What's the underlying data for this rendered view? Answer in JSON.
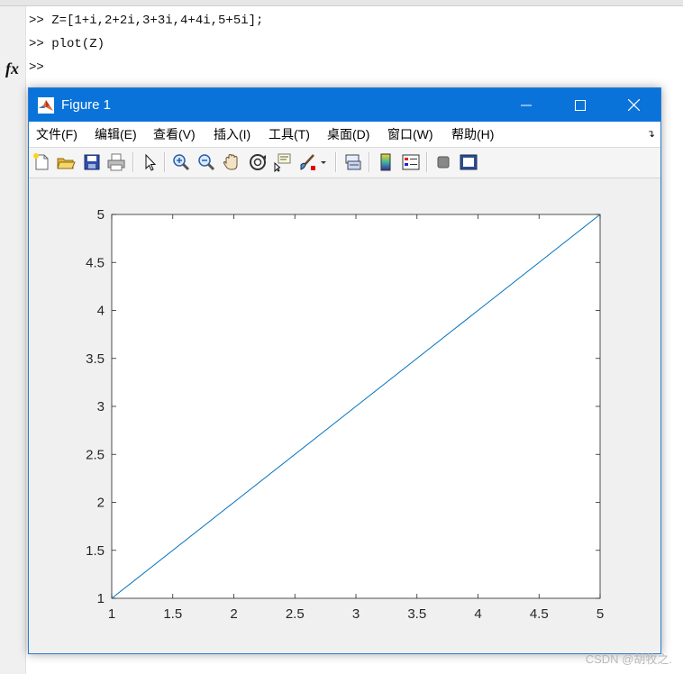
{
  "command_window": {
    "lines": [
      ">> Z=[1+i,2+2i,3+3i,4+4i,5+5i];",
      ">> plot(Z)",
      ">>"
    ],
    "fx_label": "fx"
  },
  "figure": {
    "title": "Figure 1",
    "menu": [
      "文件(F)",
      "编辑(E)",
      "查看(V)",
      "插入(I)",
      "工具(T)",
      "桌面(D)",
      "窗口(W)",
      "帮助(H)"
    ],
    "toolbar_icons": [
      "new-figure-icon",
      "open-file-icon",
      "save-icon",
      "print-icon",
      "edit-plot-arrow-icon",
      "zoom-in-icon",
      "zoom-out-icon",
      "pan-hand-icon",
      "rotate-3d-icon",
      "data-cursor-icon",
      "brush-icon",
      "brush-dropdown-icon",
      "link-plot-icon",
      "insert-colorbar-icon",
      "insert-legend-icon",
      "hide-plot-tools-icon",
      "show-plot-tools-icon"
    ]
  },
  "chart_data": {
    "type": "line",
    "x": [
      1,
      2,
      3,
      4,
      5
    ],
    "y": [
      1,
      2,
      3,
      4,
      5
    ],
    "xlim": [
      1,
      5
    ],
    "ylim": [
      1,
      5
    ],
    "xticks": [
      "1",
      "1.5",
      "2",
      "2.5",
      "3",
      "3.5",
      "4",
      "4.5",
      "5"
    ],
    "yticks": [
      "1",
      "1.5",
      "2",
      "2.5",
      "3",
      "3.5",
      "4",
      "4.5",
      "5"
    ],
    "xtick_values": [
      1,
      1.5,
      2,
      2.5,
      3,
      3.5,
      4,
      4.5,
      5
    ],
    "ytick_values": [
      1,
      1.5,
      2,
      2.5,
      3,
      3.5,
      4,
      4.5,
      5
    ],
    "line_color": "#0072BD",
    "grid": false
  },
  "colors": {
    "titlebar": "#0A73D9",
    "figure_bg": "#F0F0F0"
  },
  "watermark": "CSDN @胡牧之."
}
